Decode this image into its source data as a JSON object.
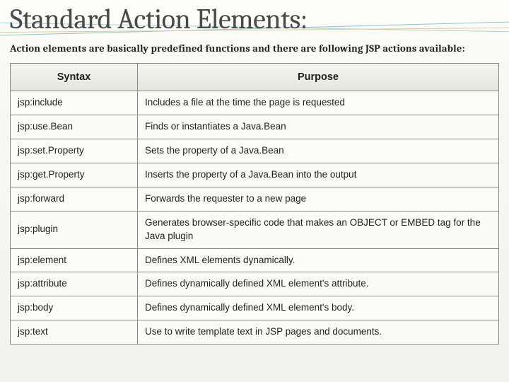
{
  "slide": {
    "title": "Standard Action Elements:",
    "description": "Action elements are basically predefined functions and there are following JSP actions available:"
  },
  "table": {
    "headers": {
      "syntax": "Syntax",
      "purpose": "Purpose"
    },
    "rows": [
      {
        "syntax": "jsp:include",
        "purpose": "Includes a file at the time the page is requested"
      },
      {
        "syntax": "jsp:use.Bean",
        "purpose": "Finds or instantiates a Java.Bean"
      },
      {
        "syntax": "jsp:set.Property",
        "purpose": "Sets the property of a Java.Bean"
      },
      {
        "syntax": "jsp:get.Property",
        "purpose": "Inserts the property of a Java.Bean into the output"
      },
      {
        "syntax": "jsp:forward",
        "purpose": "Forwards the requester to a new page"
      },
      {
        "syntax": "jsp:plugin",
        "purpose": "Generates browser-specific code that makes an OBJECT or EMBED tag for the Java plugin"
      },
      {
        "syntax": "jsp:element",
        "purpose": "Defines XML elements dynamically."
      },
      {
        "syntax": "jsp:attribute",
        "purpose": "Defines dynamically defined XML element's attribute."
      },
      {
        "syntax": "jsp:body",
        "purpose": "Defines dynamically defined XML element's body."
      },
      {
        "syntax": "jsp:text",
        "purpose": "Use to write template text in JSP pages and documents."
      }
    ]
  }
}
